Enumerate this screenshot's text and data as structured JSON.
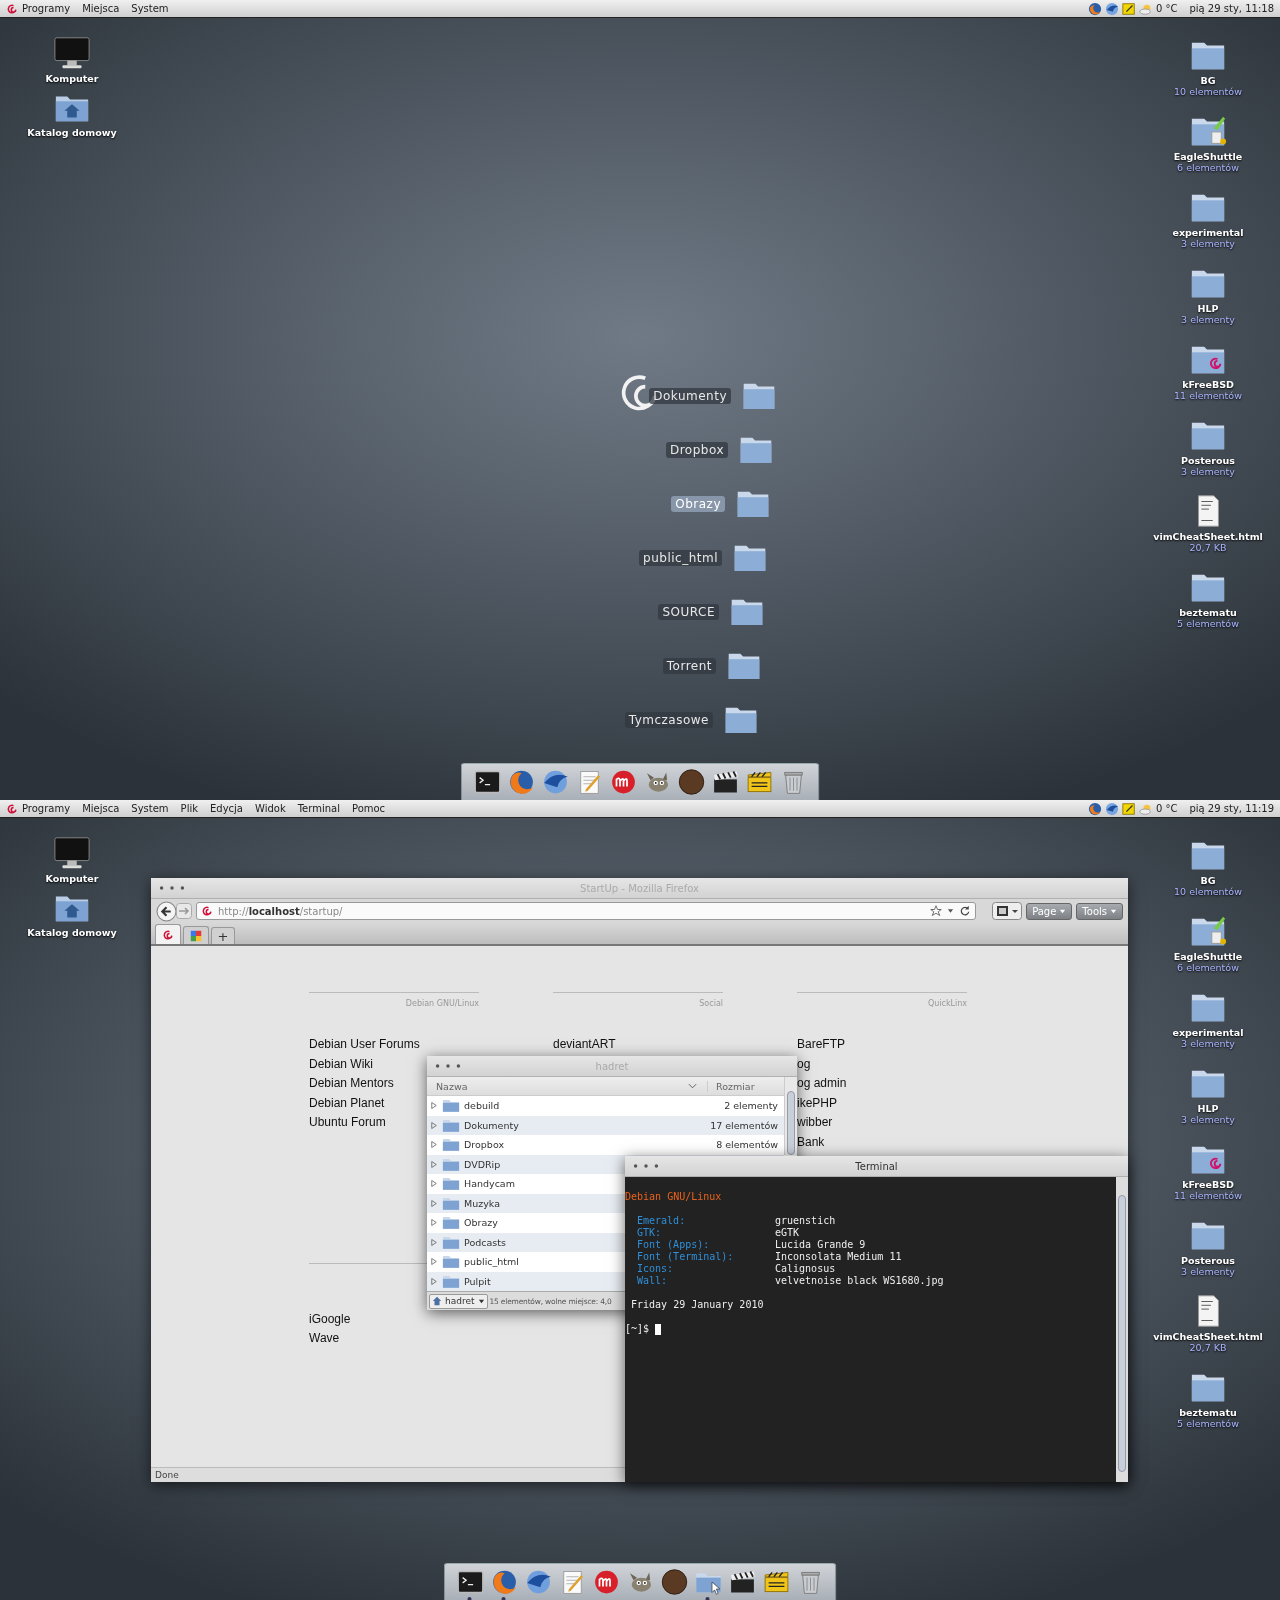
{
  "screens": [
    {
      "top_panel": {
        "menus": [
          "Programy",
          "Miejsca",
          "System"
        ],
        "temperature": "0 °C",
        "clock": "pią 29 sty, 11:18"
      },
      "desktop_icons_left": [
        {
          "kind": "computer",
          "label": "Komputer"
        },
        {
          "kind": "home",
          "label": "Katalog domowy"
        }
      ],
      "desktop_icons_right": [
        {
          "kind": "folder",
          "label": "BG",
          "detail": "10 elementów"
        },
        {
          "kind": "emblem-folder",
          "label": "EagleShuttle",
          "detail": "6 elementów"
        },
        {
          "kind": "folder",
          "label": "experimental",
          "detail": "3 elementy"
        },
        {
          "kind": "folder",
          "label": "HLP",
          "detail": "3 elementy"
        },
        {
          "kind": "swirl-folder",
          "label": "kFreeBSD",
          "detail": "11 elementów"
        },
        {
          "kind": "folder",
          "label": "Posterous",
          "detail": "3 elementy"
        },
        {
          "kind": "html-file",
          "label": "vimCheatSheet.html",
          "detail": "20,7 KB"
        },
        {
          "kind": "folder",
          "label": "beztematu",
          "detail": "5 elementów"
        }
      ],
      "stack": {
        "items": [
          {
            "label": "Dokumenty",
            "selected": false
          },
          {
            "label": "Dropbox",
            "selected": false
          },
          {
            "label": "Obrazy",
            "selected": true
          },
          {
            "label": "public_html",
            "selected": false
          },
          {
            "label": "SOURCE",
            "selected": false
          },
          {
            "label": "Torrent",
            "selected": false
          },
          {
            "label": "Tymczasowe",
            "selected": false
          }
        ]
      },
      "dock": [
        {
          "kind": "terminal"
        },
        {
          "kind": "firefox"
        },
        {
          "kind": "bird"
        },
        {
          "kind": "editor"
        },
        {
          "kind": "round-logo"
        },
        {
          "kind": "animal"
        },
        {
          "kind": "avatar"
        },
        {
          "kind": "clapper"
        },
        {
          "kind": "striped"
        },
        {
          "kind": "trash"
        }
      ]
    },
    {
      "top_panel": {
        "menus": [
          "Programy",
          "Miejsca",
          "System",
          "Plik",
          "Edycja",
          "Widok",
          "Terminal",
          "Pomoc"
        ],
        "temperature": "0 °C",
        "clock": "pią 29 sty, 11:19"
      },
      "desktop_icons_left": [
        {
          "kind": "computer",
          "label": "Komputer"
        },
        {
          "kind": "home",
          "label": "Katalog domowy"
        }
      ],
      "desktop_icons_right": [
        {
          "kind": "folder",
          "label": "BG",
          "detail": "10 elementów"
        },
        {
          "kind": "emblem-folder",
          "label": "EagleShuttle",
          "detail": "6 elementów"
        },
        {
          "kind": "folder",
          "label": "experimental",
          "detail": "3 elementy"
        },
        {
          "kind": "folder",
          "label": "HLP",
          "detail": "3 elementy"
        },
        {
          "kind": "swirl-folder",
          "label": "kFreeBSD",
          "detail": "11 elementów"
        },
        {
          "kind": "folder",
          "label": "Posterous",
          "detail": "3 elementy"
        },
        {
          "kind": "html-file",
          "label": "vimCheatSheet.html",
          "detail": "20,7 KB"
        },
        {
          "kind": "folder",
          "label": "beztematu",
          "detail": "5 elementów"
        }
      ],
      "firefox": {
        "title": "StartUp - Mozilla Firefox",
        "url": "http://**localhost**/startup/",
        "buttons": [
          "Page",
          "Tools"
        ],
        "tabs": [
          {
            "kind": "debian",
            "selected": true
          },
          {
            "kind": "google",
            "selected": false
          }
        ],
        "new_tab": "+",
        "sections": [
          {
            "columns": [
              {
                "header": "Debian GNU/Linux",
                "links": [
                  "Debian User Forums",
                  "Debian Wiki",
                  "Debian Mentors",
                  "Debian Planet",
                  "Ubuntu Forum"
                ]
              },
              {
                "header": "Social",
                "links": [
                  "deviantART"
                ]
              },
              {
                "header": "QuickLinx",
                "links": [
                  "BareFTP",
                  "og",
                  "og admin",
                  "ikePHP",
                  "wibber",
                  "Bank"
                ]
              }
            ]
          },
          {
            "columns": [
              {
                "links": [
                  "iGoogle",
                  "Wave"
                ]
              }
            ]
          }
        ],
        "status": "Done"
      },
      "file_manager": {
        "title": "hadret",
        "columns": [
          "Nazwa",
          "Rozmiar"
        ],
        "rows": [
          {
            "name": "debuild",
            "size": "2 elementy"
          },
          {
            "name": "Dokumenty",
            "size": "17 elementów"
          },
          {
            "name": "Dropbox",
            "size": "8 elementów"
          },
          {
            "name": "DVDRip"
          },
          {
            "name": "Handycam"
          },
          {
            "name": "Muzyka"
          },
          {
            "name": "Obrazy"
          },
          {
            "name": "Podcasts"
          },
          {
            "name": "public_html"
          },
          {
            "name": "Pulpit"
          }
        ],
        "location": "hadret",
        "status": "15 elementów, wolne miejsce: 4,0"
      },
      "terminal": {
        "title": "Terminal",
        "heading": "Debian GNU/Linux",
        "info": [
          {
            "key": "Emerald:",
            "value": "gruenstich"
          },
          {
            "key": "GTK:",
            "value": "eGTK"
          },
          {
            "key": "Font (Apps):",
            "value": "Lucida Grande 9"
          },
          {
            "key": "Font (Terminal):",
            "value": "Inconsolata Medium 11"
          },
          {
            "key": "Icons:",
            "value": "Calignosus"
          },
          {
            "key": "Wall:",
            "value": "velvetnoise black WS1680.jpg"
          }
        ],
        "date": "Friday 29 January 2010",
        "prompt": "[~]$"
      },
      "dock": [
        {
          "kind": "terminal",
          "running": true
        },
        {
          "kind": "firefox",
          "running": true
        },
        {
          "kind": "bird",
          "running": false
        },
        {
          "kind": "editor",
          "running": false
        },
        {
          "kind": "round-logo",
          "running": false
        },
        {
          "kind": "animal",
          "running": false
        },
        {
          "kind": "avatar",
          "running": false
        },
        {
          "kind": "folder",
          "running": true
        },
        {
          "kind": "clapper",
          "running": false
        },
        {
          "kind": "striped",
          "running": false
        },
        {
          "kind": "trash",
          "running": false
        }
      ]
    }
  ]
}
